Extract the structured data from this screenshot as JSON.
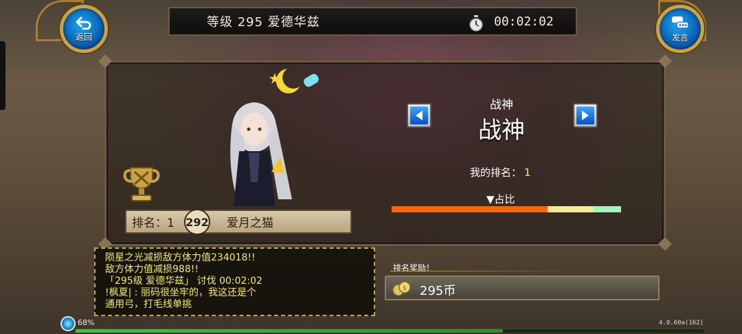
{
  "header": {
    "title": "等级 295 爱德华兹",
    "timer": "00:02:02",
    "back_label": "返回",
    "chat_label": "发言"
  },
  "ranking": {
    "title_small": "战神",
    "title_big": "战神",
    "my_rank_label": "我的排名：",
    "my_rank_value": "1",
    "ratio_label": "▼占比",
    "ratio_segments": [
      {
        "fraction": 0.68,
        "color": "#f06a10"
      },
      {
        "fraction": 0.2,
        "color": "#f2ea9a"
      },
      {
        "fraction": 0.12,
        "color": "#a8f0c0"
      }
    ]
  },
  "player_row": {
    "rank": "排名：1",
    "level": "292",
    "name": "爱月之猫"
  },
  "chat_log": [
    "陨星之光减损敌方体力值234018!!",
    "敌方体力值减损988!!",
    "「295级 爱德华兹」 讨伐 00:02:02",
    "!枫夏|        : 丽码很坐牢的，我这还是个",
    "通用弓，打毛线单挑"
  ],
  "reward": {
    "label": "排名奖励！",
    "amount": "295币"
  },
  "status": {
    "percent": "68%",
    "progress": 0.68,
    "version": "4.0.60a(162)"
  },
  "colors": {
    "frame_gold": "#c9a34a",
    "chat_text": "#f4e96a",
    "button_blue": "#0b5fb0"
  }
}
